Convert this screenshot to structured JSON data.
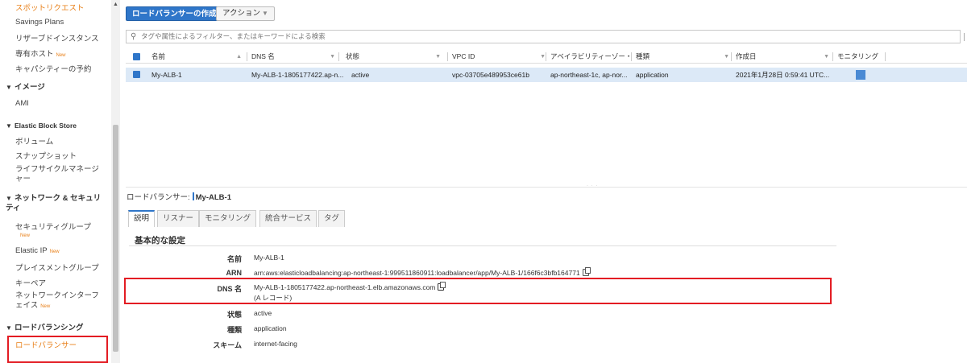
{
  "sidebar": {
    "spot": "スポットリクエスト",
    "savings": "Savings Plans",
    "reserved": "リザーブドインスタンス",
    "dedicated": "専有ホスト",
    "capacity": "キャパシティーの予約",
    "images_head": "イメージ",
    "ami": "AMI",
    "ebs_head": "Elastic Block Store",
    "volumes": "ボリューム",
    "snapshots": "スナップショット",
    "lifecycle": "ライフサイクルマネージャー",
    "network_head": "ネットワーク & セキュリティ",
    "security_groups": "セキュリティグループ",
    "elastic_ip": "Elastic IP",
    "placement": "プレイスメントグループ",
    "keypair": "キーペア",
    "eni": "ネットワークインターフェイス",
    "lb_head": "ロードバランシング",
    "lb": "ロードバランサー",
    "new_badge": "New"
  },
  "toolbar": {
    "create": "ロードバランサーの作成",
    "actions": "アクション"
  },
  "filter": {
    "placeholder": "タグや属性によるフィルター、またはキーワードによる検索"
  },
  "table": {
    "columns": [
      "名前",
      "DNS 名",
      "状態",
      "VPC ID",
      "アベイラビリティーゾー・",
      "種類",
      "作成日",
      "モニタリング"
    ],
    "rows": [
      {
        "name": "My-ALB-1",
        "dns": "My-ALB-1-1805177422.ap-n...",
        "state": "active",
        "vpc": "vpc-03705e489953ce61b",
        "az": "ap-northeast-1c, ap-nor...",
        "type": "application",
        "created": "2021年1月28日 0:59:41 UTC..."
      }
    ]
  },
  "detail": {
    "prefix": "ロードバランサー:",
    "name": "My-ALB-1",
    "tabs": [
      "説明",
      "リスナー",
      "モニタリング",
      "統合サービス",
      "タグ"
    ],
    "section": "基本的な設定",
    "labels": {
      "name": "名前",
      "arn": "ARN",
      "dns": "DNS 名",
      "state": "状態",
      "type": "種類",
      "scheme": "スキーム"
    },
    "values": {
      "name": "My-ALB-1",
      "arn": "arn:aws:elasticloadbalancing:ap-northeast-1:999511860911:loadbalancer/app/My-ALB-1/166f6c3bfb164771",
      "dns": "My-ALB-1-1805177422.ap-northeast-1.elb.amazonaws.com",
      "dns_record": "(A レコード)",
      "state": "active",
      "type": "application",
      "scheme": "internet-facing"
    }
  },
  "colors": {
    "accent": "#2f76c9",
    "orange": "#e8801a",
    "highlight": "#e31c23",
    "row_selected": "#dce9f7"
  }
}
